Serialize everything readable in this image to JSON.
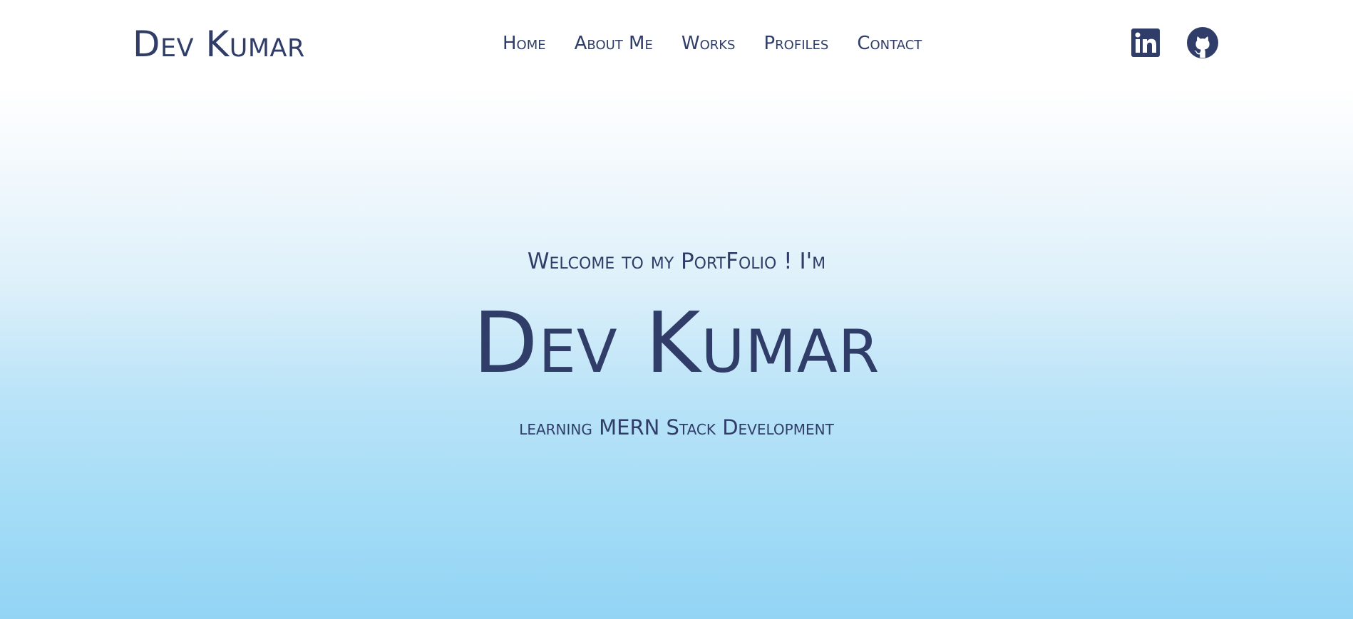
{
  "header": {
    "brand": "Dev Kumar",
    "nav": [
      {
        "label": "Home"
      },
      {
        "label": "About Me"
      },
      {
        "label": "Works"
      },
      {
        "label": "Profiles"
      },
      {
        "label": "Contact"
      }
    ],
    "social": [
      {
        "icon": "linkedin-icon"
      },
      {
        "icon": "github-icon"
      }
    ]
  },
  "hero": {
    "welcome": "Welcome to my PortFolio ! I'm",
    "name": "Dev Kumar",
    "tagline": "learning MERN Stack Development"
  },
  "colors": {
    "text": "#2f3d68",
    "gradient_top": "#ffffff",
    "gradient_bottom": "#93d4f5"
  }
}
